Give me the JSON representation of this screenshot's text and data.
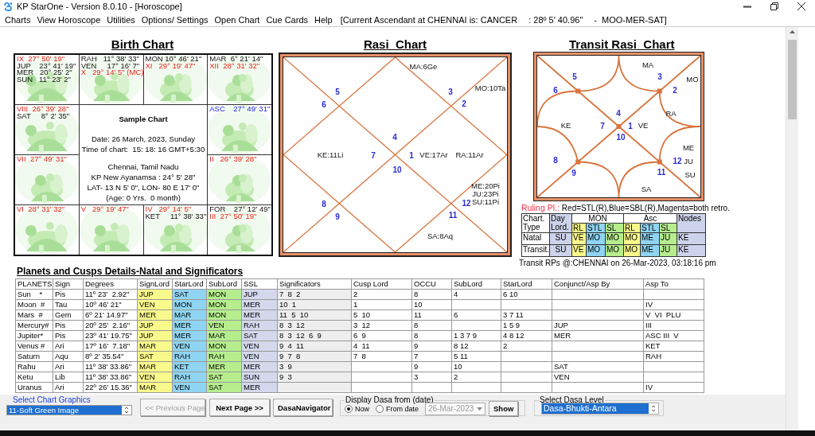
{
  "window": {
    "title": "KP StarOne - Version 8.0.10 - [Horoscope]"
  },
  "menu": [
    "Charts",
    "View Horoscope",
    "Utilities",
    "Options/ Settings",
    "Open Chart",
    "Cue Cards",
    "Help"
  ],
  "status": [
    "[Current Ascendant at CHENNAI is: CANCER",
    ": 28º 5' 40.96\"",
    "-  MOO-MER-SAT]"
  ],
  "birth_chart": {
    "title": "Birth Chart",
    "cells": [
      {
        "lines": [
          {
            "kind": "house",
            "text": "IX  27° 50' 19\""
          },
          {
            "kind": "planet",
            "text": "JUP    23° 41' 19\""
          },
          {
            "kind": "planet",
            "text": "MER   20° 25' 2\""
          },
          {
            "kind": "planet",
            "text": "SUN   11° 23' 2\""
          }
        ]
      },
      {
        "lines": [
          {
            "kind": "planet",
            "text": "RAH   11° 38' 33\""
          },
          {
            "kind": "planet",
            "text": "VEN     17° 16' 7\""
          },
          {
            "kind": "house",
            "text": "X   29° 14' 5\" (MC)"
          }
        ]
      },
      {
        "lines": [
          {
            "kind": "planet",
            "text": "MON 10° 46' 21\""
          },
          {
            "kind": "house",
            "text": "XI   29° 19' 47\""
          }
        ]
      },
      {
        "lines": [
          {
            "kind": "planet",
            "text": "MAR  6° 21' 14\""
          },
          {
            "kind": "house",
            "text": "XII  28° 31' 32\""
          }
        ]
      },
      {
        "lines": [
          {
            "kind": "house",
            "text": "VIII  26° 39' 28\""
          },
          {
            "kind": "planet",
            "text": "SAT     8° 2' 35\""
          }
        ]
      },
      {
        "lines": [
          {
            "kind": "asc",
            "text": "ASC    27° 49' 31\""
          }
        ]
      },
      {
        "lines": [
          {
            "kind": "house",
            "text": "VII  27° 49' 31\""
          }
        ]
      },
      {
        "lines": [
          {
            "kind": "house",
            "text": "II   26° 39' 28\""
          }
        ]
      },
      {
        "lines": [
          {
            "kind": "house",
            "text": "VI  28° 31' 32\""
          }
        ]
      },
      {
        "lines": [
          {
            "kind": "house",
            "text": "V   29° 19' 47\""
          }
        ]
      },
      {
        "lines": [
          {
            "kind": "house",
            "text": "IV   29° 14' 5\""
          },
          {
            "kind": "planet",
            "text": "KET     11° 38' 33\""
          }
        ]
      },
      {
        "lines": [
          {
            "kind": "planet",
            "text": "FOR    27° 12' 49\""
          },
          {
            "kind": "house",
            "text": "III  27° 50' 19\""
          }
        ]
      }
    ],
    "center": {
      "title": "Sample Chart",
      "blocks": [
        [
          "Date: 26 March, 2023, Sunday",
          "Time of chart:  15: 18: 16 GMT+5:30"
        ],
        [
          "Chennai, Tamil Nadu",
          "KP New Ayanamsa : 24° 5' 28\"",
          "LAT- 13 N 5' 0\", LON- 80 E 17' 0\"",
          "(Age: 0 Yrs.  0 month)"
        ]
      ]
    }
  },
  "rasi_chart": {
    "title": "Rasi  Chart",
    "houses": [
      {
        "number": "1",
        "planets": [
          "VE:17Ar",
          "RA:11Ar"
        ]
      },
      {
        "number": "2",
        "planets": [
          "MO:10Ta"
        ]
      },
      {
        "number": "3",
        "planets": [
          "MA:6Ge"
        ]
      },
      {
        "number": "4"
      },
      {
        "number": "5"
      },
      {
        "number": "6"
      },
      {
        "number": "7",
        "planets": [
          "KE:11Li"
        ]
      },
      {
        "number": "8"
      },
      {
        "number": "9"
      },
      {
        "number": "10"
      },
      {
        "number": "11",
        "planets": [
          "SA:8Aq"
        ]
      },
      {
        "number": "12",
        "planets": [
          "ME:20Pi",
          "JU:23Pi",
          "SU:11Pi"
        ]
      }
    ]
  },
  "transit_chart": {
    "title": "Transit Rasi  Chart",
    "houses": [
      {
        "number": "1",
        "planets": [
          "VE",
          "RA"
        ]
      },
      {
        "number": "2",
        "planets": [
          "MO"
        ]
      },
      {
        "number": "3",
        "planets": [
          "MA"
        ]
      },
      {
        "number": "4"
      },
      {
        "number": "5"
      },
      {
        "number": "6"
      },
      {
        "number": "7",
        "planets": [
          "KE"
        ]
      },
      {
        "number": "8"
      },
      {
        "number": "9"
      },
      {
        "number": "10"
      },
      {
        "number": "11",
        "planets": [
          "SA"
        ]
      },
      {
        "number": "12",
        "planets": [
          "ME",
          "JU",
          "SU"
        ]
      }
    ]
  },
  "ruling": {
    "legend_label": "Ruling Pl.:",
    "legend": "Red=STL(R),Blue=SBL(R),Magenta=both retro.",
    "chart_type": "Chart. Type",
    "day_lord": "Day Lord.",
    "groups": [
      "MON",
      "Asc"
    ],
    "nodes": "Nodes",
    "sub": [
      "RL",
      "STL",
      "SL",
      "RL",
      "STL",
      "SL"
    ],
    "rows": [
      {
        "label": "Natal",
        "cells": [
          "SU",
          "VE",
          "MO",
          "MO",
          "MO",
          "ME",
          "JU",
          "KE"
        ]
      },
      {
        "label": "Transit.",
        "cells": [
          "SU",
          "VE",
          "MO",
          "MO",
          "MO",
          "ME",
          "JU",
          "KE"
        ]
      }
    ],
    "footer": "Transit RPs @:CHENNAI on 26-Mar-2023, 03:18:16 pm"
  },
  "planets_table": {
    "title": "Planets and Cusps Details-Natal and Significators",
    "columns": [
      "PLANETS",
      "Sign",
      "Degrees",
      "SignLord",
      "StarLord",
      "SubLord",
      "SSL",
      "Significators",
      "Cusp Lord",
      "OCCU",
      "SubLord",
      "StarLord",
      "Conjunct/Asp By",
      "Asp To"
    ],
    "rows": [
      [
        "Sun    *",
        "Pis",
        "11º 23'  2.92\"",
        "JUP",
        "SAT",
        "MON",
        "JUP",
        "7  8  2",
        "2",
        "8",
        "4",
        "6 10",
        null,
        null
      ],
      [
        "Moon  #",
        "Tau",
        "10º 46' 21\"",
        "VEN",
        "MON",
        "MON",
        "MER",
        "10  1",
        "1",
        "10",
        null,
        null,
        null,
        "IV"
      ],
      [
        "Mars  #",
        "Gem",
        "6º 21' 14.97\"",
        "MER",
        "MAR",
        "MON",
        "MER",
        "11  5  10",
        "5  10",
        "11",
        "6",
        "3 7 11",
        null,
        "V  VI  PLU"
      ],
      [
        "Mercury#",
        "Pis",
        "20º 25'  2.16\"",
        "JUP",
        "MER",
        "VEN",
        "RAH",
        "8  3  12",
        "3  12",
        "8",
        null,
        "1 5 9",
        "JUP",
        "III"
      ],
      [
        "Jupiter*",
        "Pis",
        "23º 41' 19.75\"",
        "JUP",
        "MER",
        "MAR",
        "SAT",
        "8  3  12  6  9",
        "6  9",
        "8",
        "1 3 7 9",
        "4 8 12",
        "MER",
        "ASC III  V"
      ],
      [
        "Venus #",
        "Ari",
        "17º 16'  7.18\"",
        "MAR",
        "VEN",
        "MON",
        "VEN",
        "9  4  11",
        "4  11",
        "9",
        "8 12",
        "2",
        null,
        "KET"
      ],
      [
        "Saturn",
        "Aqu",
        "8º 2' 35.54\"",
        "SAT",
        "RAH",
        "RAH",
        "VEN",
        "9  7  8",
        "7  8",
        "7",
        "5 11",
        null,
        null,
        "RAH"
      ],
      [
        "Rahu",
        "Ari",
        "11º 38' 33.86\"",
        "MAR",
        "KET",
        "MER",
        "MER",
        "3  9",
        null,
        "9",
        "10",
        null,
        "SAT",
        null
      ],
      [
        "Ketu",
        "Lib",
        "11º 38' 33.86\"",
        "VEN",
        "RAH",
        "SAT",
        "SUN",
        "9  3",
        null,
        "3",
        "2",
        null,
        "VEN",
        null
      ],
      [
        "Uranus",
        "Ari",
        "22º 26' 15.36\"",
        "MAR",
        "VEN",
        "SAT",
        "MER",
        null,
        null,
        null,
        null,
        null,
        null,
        "IV"
      ]
    ]
  },
  "bottom": {
    "graphics_label": "Select Chart Graphics",
    "graphics_value": "11-Soft Green Image",
    "buttons": [
      {
        "label": "<< Previous Page",
        "disabled": true
      },
      {
        "label": "Next Page >>",
        "disabled": false
      },
      {
        "label": "DasaNavigator",
        "disabled": false
      }
    ],
    "dasa_from": {
      "legend": "Display Dasa from (date)",
      "options": [
        {
          "label": "Now",
          "selected": true
        },
        {
          "label": "From date",
          "selected": false
        }
      ],
      "date": "26-Mar-2023",
      "date_disabled": true,
      "show": "Show"
    },
    "dasa_level": {
      "legend": "Select Dasa Level",
      "value": "Dasa-Bhukti-Antara"
    }
  }
}
